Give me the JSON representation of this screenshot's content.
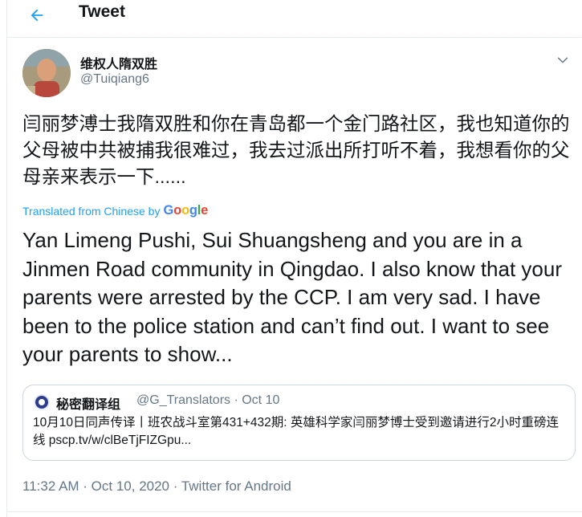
{
  "header": {
    "title": "Tweet",
    "back_icon": "arrow-left-icon"
  },
  "tweet": {
    "display_name": "维权人隋双胜",
    "handle": "@Tuiqiang6",
    "original_text": "闫丽梦溥士我隋双胜和你在青岛都一个金门路社区，我也知道你的父母被中共被捕我很难过，我去过派出所打听不着，我想看你的父母亲来表示一下......",
    "translated_label": "Translated from Chinese by",
    "google_logo": "Google",
    "translated_text": "Yan Limeng Pushi, Sui Shuangsheng and you are in a Jinmen Road community in Qingdao. I also know that your parents were arrested by the CCP. I am very sad. I have been to the police station and can’t find out. I want to see your parents to show...",
    "timestamp": "11:32 AM · Oct 10, 2020 · Twitter for Android"
  },
  "quoted_tweet": {
    "display_name": "秘密翻译组",
    "meta": "@G_Translators · Oct 10",
    "text": "10月10日同声传译丨班农战斗室第431+432期: 英雄科学家闫丽梦博士受到邀请进行2小时重磅连线 pscp.tv/w/clBeTjFIZGpu..."
  },
  "colors": {
    "accent": "#1da1f2",
    "text_primary": "#14171a",
    "text_secondary": "#657786",
    "border": "#e6ecf0"
  }
}
